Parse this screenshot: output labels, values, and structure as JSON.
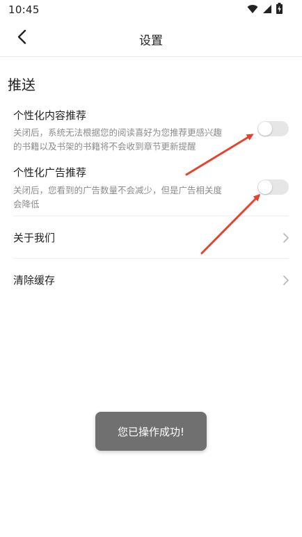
{
  "status_bar": {
    "time": "10:45",
    "icons": [
      "wifi-icon",
      "signal-icon",
      "battery-charging-icon"
    ]
  },
  "nav": {
    "title": "设置",
    "back_icon": "chevron-left-icon"
  },
  "section": {
    "title": "推送"
  },
  "settings": [
    {
      "title": "个性化内容推荐",
      "desc_line1": "关闭后，系统无法根据您的阅读喜好为您推荐更感兴趣",
      "desc_line2": "的书籍以及书架的书籍将不会收到章节更新提醒",
      "enabled": false
    },
    {
      "title": "个性化广告推荐",
      "desc_line1": "关闭后，您看到的广告数量不会减少，但是广告相关度",
      "desc_line2": "会降低",
      "enabled": false
    }
  ],
  "list": [
    {
      "label": "关于我们"
    },
    {
      "label": "清除缓存"
    }
  ],
  "toast": {
    "text": "您已操作成功!"
  },
  "colors": {
    "annotation_arrow": "#e8412c",
    "toggle_off": "#e6e6e6",
    "toast_bg": "#707070",
    "desc_text": "#8c8c8c"
  }
}
